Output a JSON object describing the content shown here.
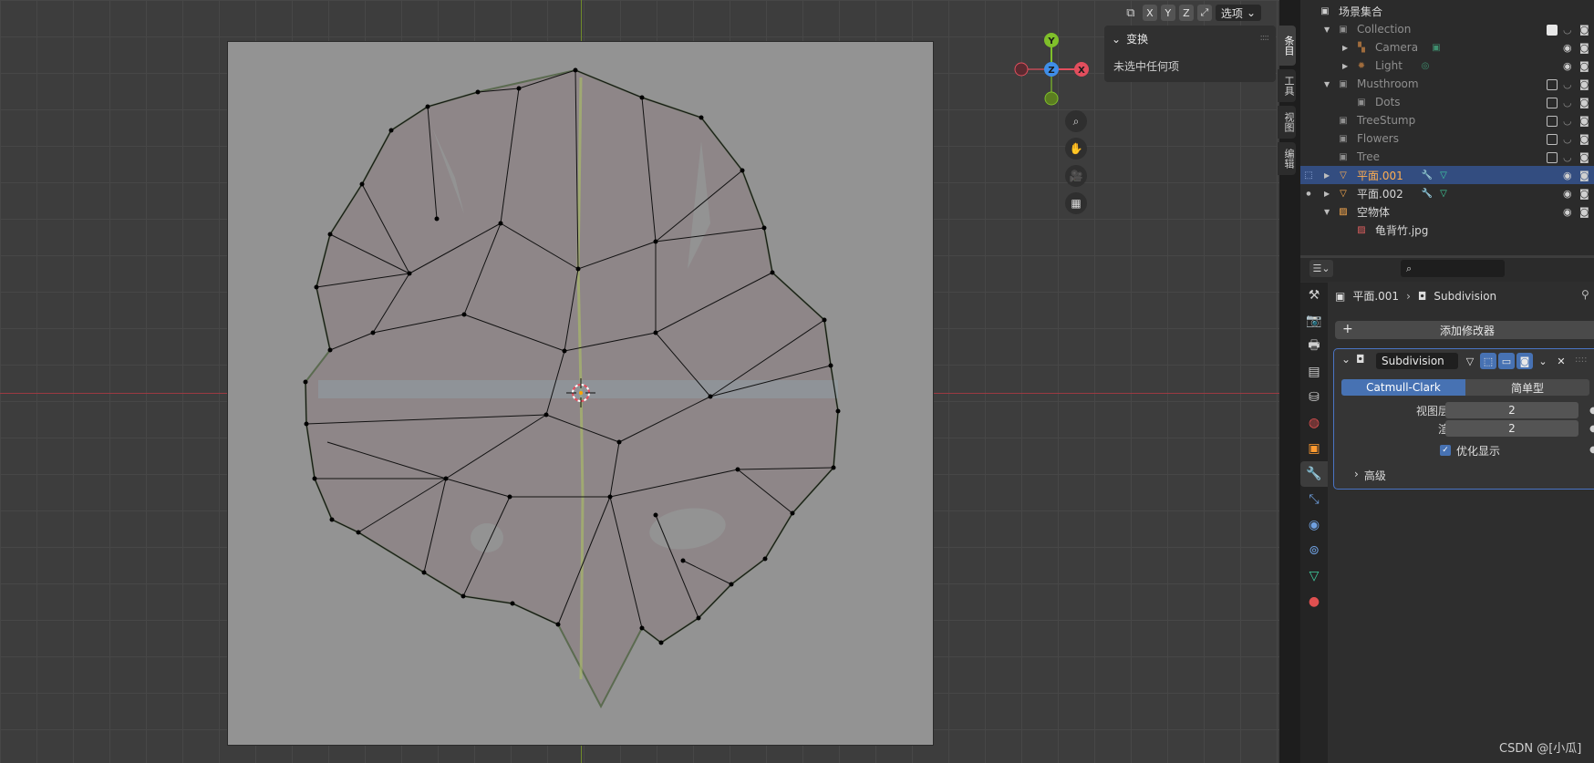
{
  "viewport": {
    "header": {
      "axes": [
        "X",
        "Y",
        "Z"
      ],
      "options_label": "选项"
    },
    "npanel": {
      "title": "变换",
      "empty_text": "未选中任何项"
    },
    "side_tabs": [
      "条目",
      "工具",
      "视图",
      "编辑"
    ],
    "gizmo": {
      "y": "Y",
      "z": "Z",
      "x": "X"
    },
    "colors": {
      "x_axis": "#e24e5d",
      "y_axis": "#7fbf2a",
      "z_axis": "#3f8ee8"
    }
  },
  "outliner": {
    "title": "场景集合",
    "rows": [
      {
        "label": "Collection"
      },
      {
        "label": "Camera"
      },
      {
        "label": "Light"
      },
      {
        "label": "Musthroom"
      },
      {
        "label": "Dots"
      },
      {
        "label": "TreeStump"
      },
      {
        "label": "Flowers"
      },
      {
        "label": "Tree"
      },
      {
        "label": "平面.001"
      },
      {
        "label": "平面.002"
      },
      {
        "label": "空物体"
      },
      {
        "label": "龟背竹.jpg"
      }
    ]
  },
  "properties": {
    "search_placeholder": "",
    "breadcrumb_object": "平面.001",
    "breadcrumb_modifier": "Subdivision",
    "add_modifier_label": "添加修改器",
    "modifier": {
      "name": "Subdivision",
      "mode_tabs": [
        "Catmull-Clark",
        "简单型"
      ],
      "viewport_levels_label": "视图层级",
      "viewport_levels_value": "2",
      "render_label": "渲染",
      "render_value": "2",
      "optimal_display_label": "优化显示",
      "advanced_label": "高级"
    }
  },
  "watermark": "CSDN @[小瓜]"
}
